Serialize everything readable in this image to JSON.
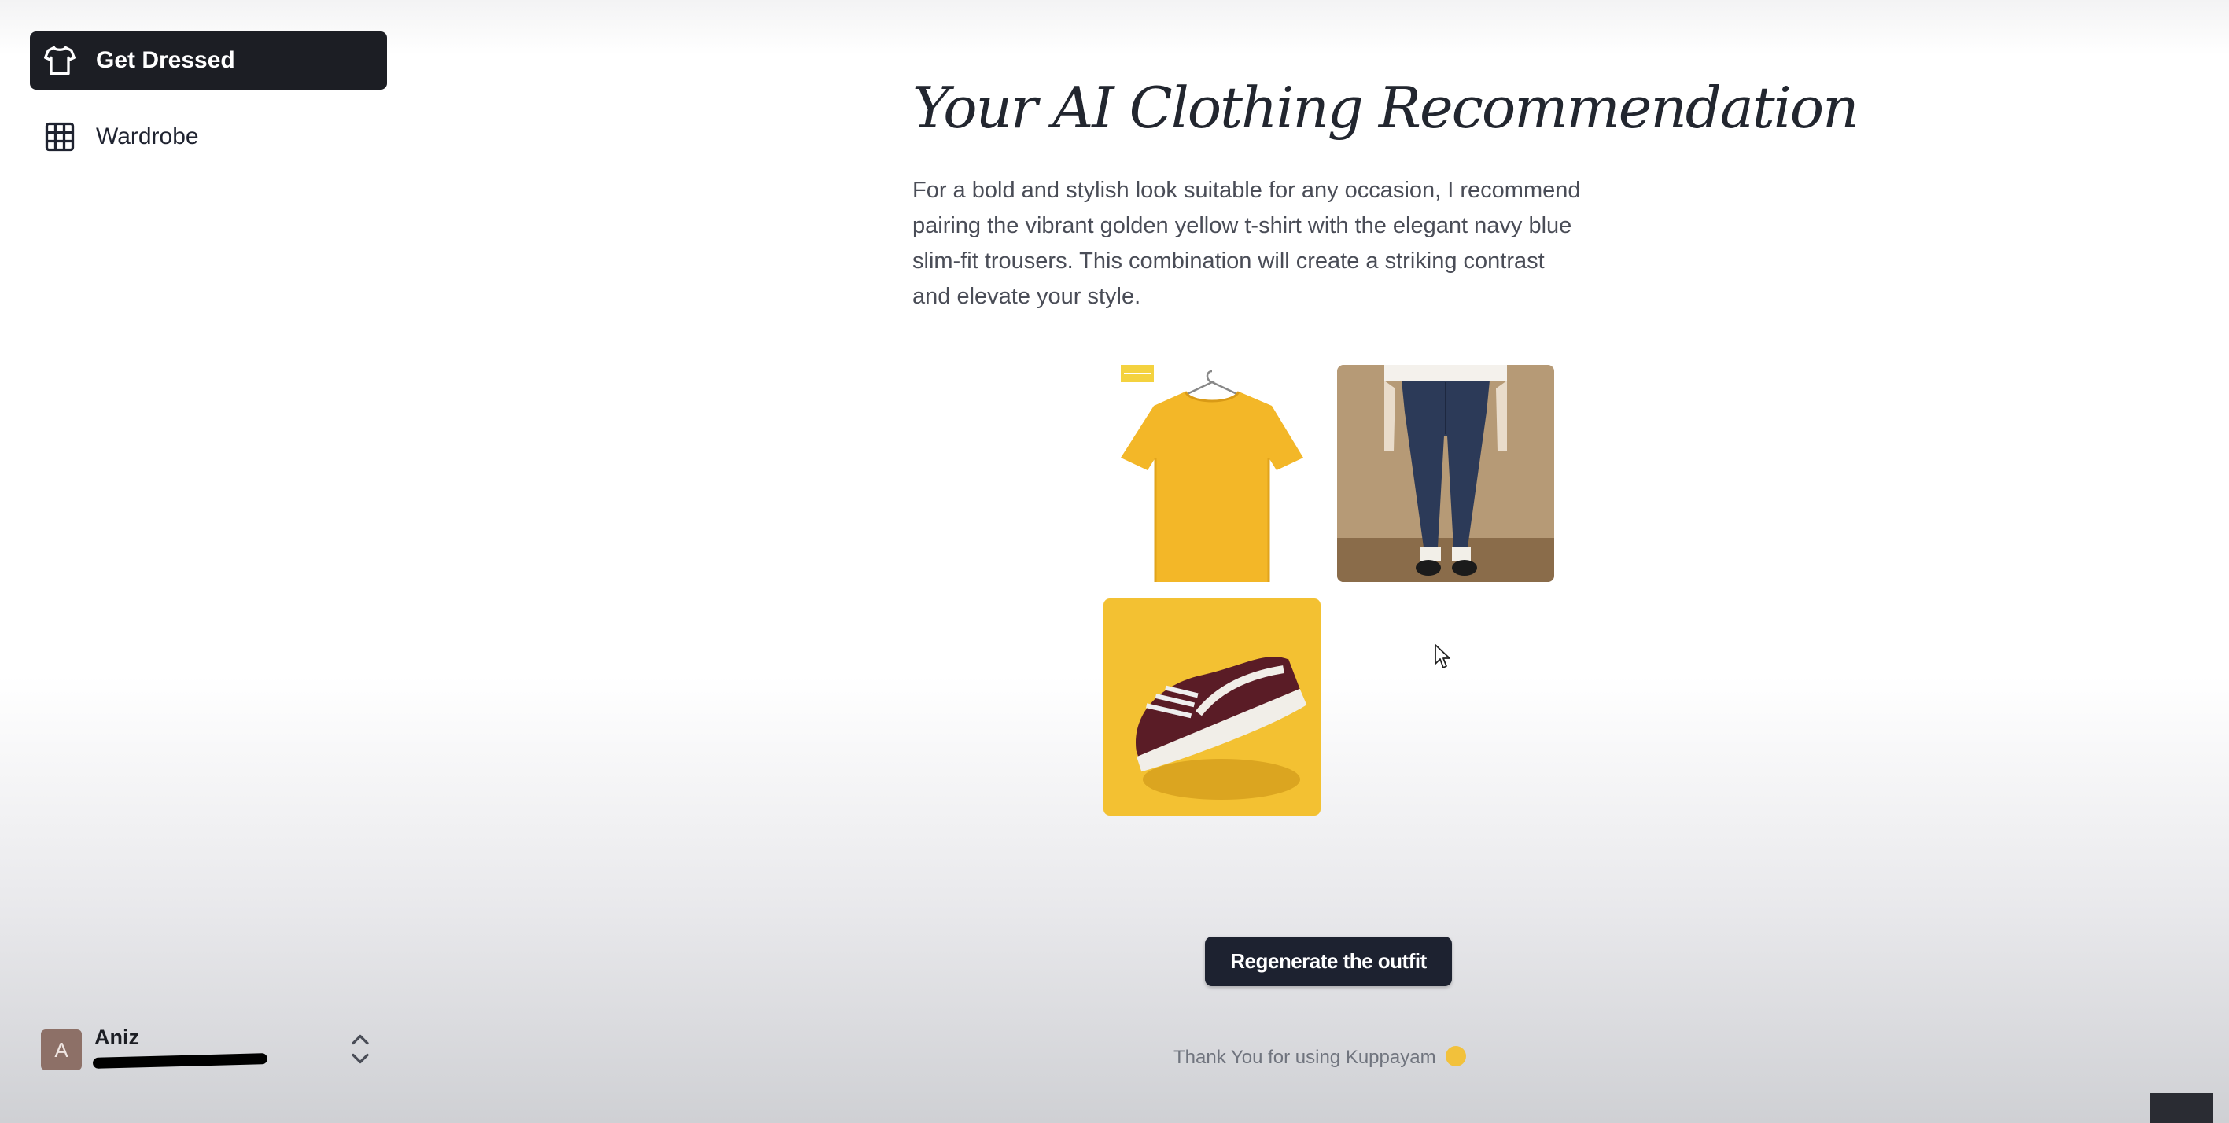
{
  "sidebar": {
    "items": [
      {
        "label": "Get Dressed",
        "icon": "shirt-icon",
        "active": true
      },
      {
        "label": "Wardrobe",
        "icon": "grid-icon",
        "active": false
      }
    ]
  },
  "user": {
    "initial": "A",
    "name": "Aniz",
    "email": "",
    "avatar_color": "#8d7067"
  },
  "main": {
    "title": "Your AI Clothing Recommendation",
    "description": "For a bold and stylish look suitable for any occasion, I recommend pairing the vibrant golden yellow t-shirt with the elegant navy blue slim-fit trousers. This combination will create a striking contrast and elevate your style.",
    "outfit_items": [
      {
        "name": "golden yellow t-shirt",
        "color": "#f3b728"
      },
      {
        "name": "navy blue slim-fit trousers",
        "color": "#2c3a58"
      },
      {
        "name": "maroon sneakers",
        "color": "#5a1c26"
      }
    ],
    "regenerate_label": "Regenerate the outfit",
    "thanks_text": "Thank You for using Kuppayam"
  },
  "colors": {
    "active_nav_bg": "#1c1e24",
    "button_bg": "#1d2230",
    "text_muted": "#4a4d57"
  }
}
